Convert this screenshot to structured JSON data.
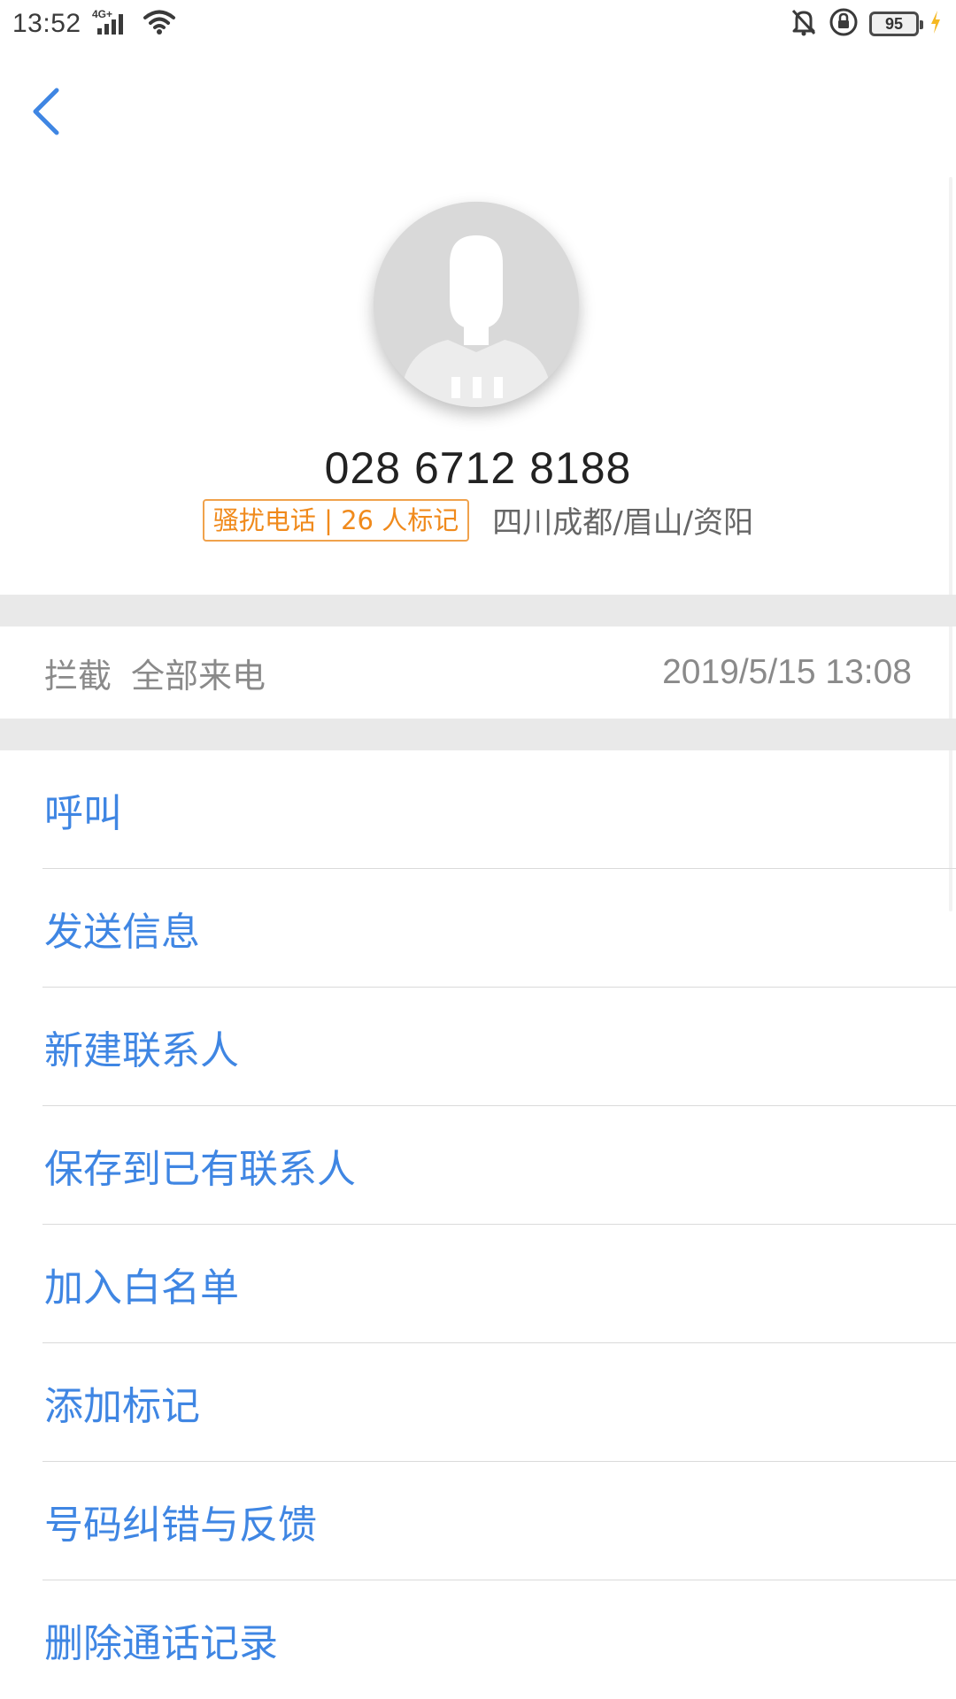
{
  "status_bar": {
    "time": "13:52",
    "network": "4G+",
    "battery": "95",
    "icons": [
      "signal-icon",
      "wifi-icon",
      "mute-icon",
      "rotation-lock-icon",
      "battery-icon",
      "charging-icon"
    ]
  },
  "header": {
    "phone_number": "028 6712 8188",
    "spam_badge": "骚扰电话 | 26 人标记",
    "location": "四川成都/眉山/资阳"
  },
  "block_info": {
    "label": "拦截",
    "type": "全部来电",
    "time": "2019/5/15 13:08"
  },
  "actions": [
    {
      "label": "呼叫"
    },
    {
      "label": "发送信息"
    },
    {
      "label": "新建联系人"
    },
    {
      "label": "保存到已有联系人"
    },
    {
      "label": "加入白名单"
    },
    {
      "label": "添加标记"
    },
    {
      "label": "号码纠错与反馈"
    },
    {
      "label": "删除通话记录"
    }
  ],
  "colors": {
    "accent": "#3f86e3",
    "spam": "#f08a1c",
    "divider": "#e9e9e9"
  }
}
